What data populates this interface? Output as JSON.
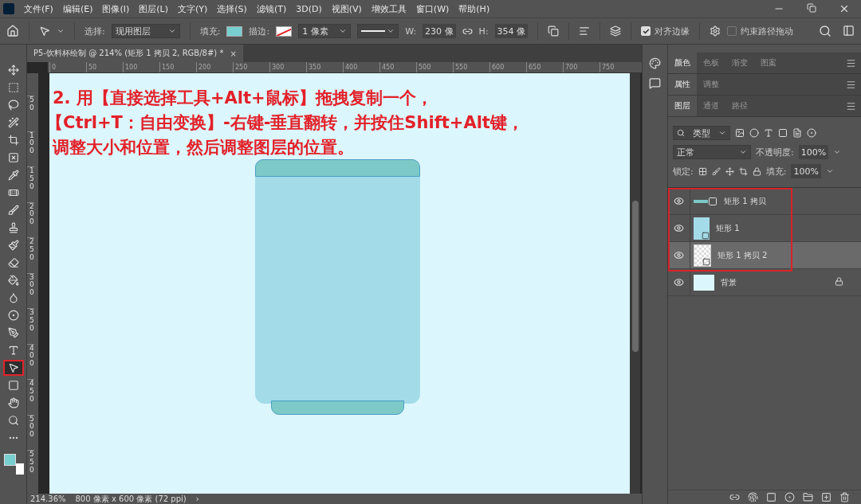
{
  "menu": [
    "文件(F)",
    "编辑(E)",
    "图像(I)",
    "图层(L)",
    "文字(Y)",
    "选择(S)",
    "滤镜(T)",
    "3D(D)",
    "视图(V)",
    "增效工具",
    "窗口(W)",
    "帮助(H)"
  ],
  "options": {
    "select_label": "选择:",
    "select_value": "现用图层",
    "fill_label": "填充:",
    "stroke_label": "描边:",
    "stroke_width": "1 像素",
    "w_label": "W:",
    "w_value": "230 像",
    "h_label": "H:",
    "h_value": "354 像",
    "align_edges": {
      "label": "对齐边缘",
      "checked": true
    },
    "constrain_path": {
      "label": "约束路径拖动",
      "checked": false
    }
  },
  "document": {
    "tab_title": "P5-饮料杯绘制 @ 214% (矩形 1 拷贝 2, RGB/8#) *",
    "close": "×"
  },
  "rulers": {
    "horizontal": [
      "0",
      "50",
      "100",
      "150",
      "200",
      "250",
      "300",
      "350",
      "400",
      "450",
      "500",
      "550",
      "600",
      "650",
      "700",
      "750"
    ],
    "vertical": [
      "50",
      "100",
      "150",
      "200",
      "250",
      "300",
      "350",
      "400",
      "450",
      "500",
      "550"
    ]
  },
  "tools": [
    {
      "kind": "move",
      "selected": false
    },
    {
      "kind": "marquee",
      "selected": false
    },
    {
      "kind": "lasso",
      "selected": false
    },
    {
      "kind": "quick-select",
      "selected": false
    },
    {
      "kind": "crop",
      "selected": false
    },
    {
      "kind": "frame",
      "selected": false
    },
    {
      "kind": "eyedropper",
      "selected": false
    },
    {
      "kind": "healing",
      "selected": false
    },
    {
      "kind": "brush",
      "selected": false
    },
    {
      "kind": "stamp",
      "selected": false
    },
    {
      "kind": "history-brush",
      "selected": false
    },
    {
      "kind": "eraser",
      "selected": false
    },
    {
      "kind": "bucket",
      "selected": false
    },
    {
      "kind": "smudge",
      "selected": false
    },
    {
      "kind": "sponge",
      "selected": false
    },
    {
      "kind": "pen",
      "selected": false
    },
    {
      "kind": "type",
      "selected": false
    },
    {
      "kind": "direct-select",
      "selected": true
    },
    {
      "kind": "rectangle",
      "selected": false
    },
    {
      "kind": "hand",
      "selected": false
    },
    {
      "kind": "zoom",
      "selected": false
    },
    {
      "kind": "more",
      "selected": false
    }
  ],
  "annotation": [
    "2. 用【直接选择工具+Alt+鼠标】拖拽复制一个，",
    "【Ctrl+T：自由变换】-右键-垂直翻转，并按住Shift+Alt键，",
    "调整大小和位置，然后调整图层的位置。"
  ],
  "panel_groups": [
    [
      {
        "label": "颜色",
        "selected": true
      },
      {
        "label": "色板",
        "selected": false
      },
      {
        "label": "渐变",
        "selected": false
      },
      {
        "label": "图案",
        "selected": false
      }
    ],
    [
      {
        "label": "属性",
        "selected": true
      },
      {
        "label": "调整",
        "selected": false
      }
    ],
    [
      {
        "label": "图层",
        "selected": true
      },
      {
        "label": "通道",
        "selected": false
      },
      {
        "label": "路径",
        "selected": false
      }
    ]
  ],
  "layers_panel": {
    "filter": "类型",
    "blend_mode": "正常",
    "opacity_label": "不透明度:",
    "opacity": "100%",
    "lock_label": "锁定:",
    "fill_label": "填充:",
    "fill": "100%"
  },
  "layers": [
    {
      "name": "矩形 1 拷贝",
      "kind": "bar",
      "selected": false,
      "highlighted": true,
      "locked": false
    },
    {
      "name": "矩形 1",
      "kind": "shape",
      "selected": false,
      "highlighted": true,
      "locked": false
    },
    {
      "name": "矩形 1 拷贝 2",
      "kind": "transparent",
      "selected": true,
      "highlighted": true,
      "locked": false
    },
    {
      "name": "背景",
      "kind": "fill",
      "selected": false,
      "highlighted": false,
      "locked": true
    }
  ],
  "status": {
    "zoom": "214.36%",
    "size": "800 像素 x 600 像素 (72 ppi)",
    "arrow": "›"
  }
}
